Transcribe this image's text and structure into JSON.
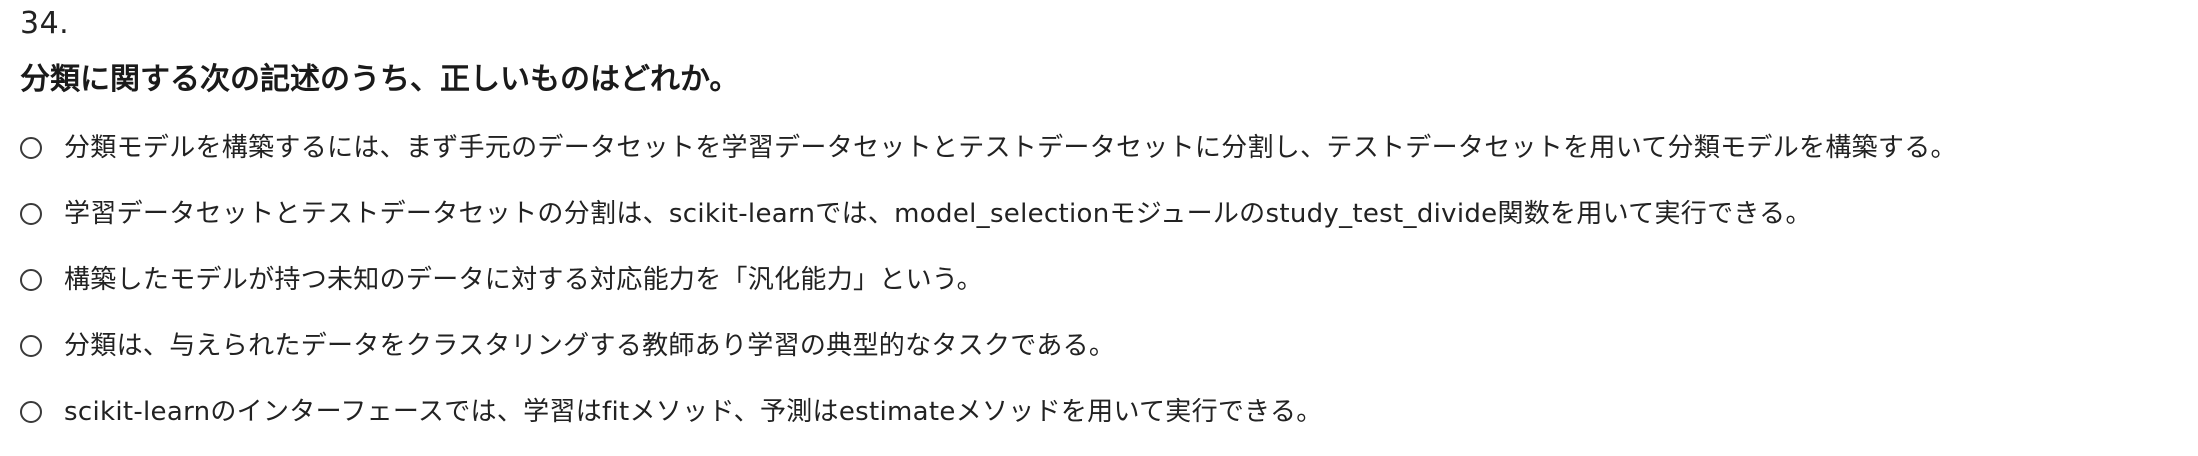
{
  "question": {
    "number": "34.",
    "title": "分類に関する次の記述のうち、正しいものはどれか。"
  },
  "options": [
    {
      "label": "分類モデルを構築するには、まず手元のデータセットを学習データセットとテストデータセットに分割し、テストデータセットを用いて分類モデルを構築する。"
    },
    {
      "label": "学習データセットとテストデータセットの分割は、scikit-learnでは、model_selectionモジュールのstudy_test_divide関数を用いて実行できる。"
    },
    {
      "label": "構築したモデルが持つ未知のデータに対する対応能力を「汎化能力」という。"
    },
    {
      "label": "分類は、与えられたデータをクラスタリングする教師あり学習の典型的なタスクである。"
    },
    {
      "label": "scikit-learnのインターフェースでは、学習はfitメソッド、予測はestimateメソッドを用いて実行できる。"
    }
  ]
}
